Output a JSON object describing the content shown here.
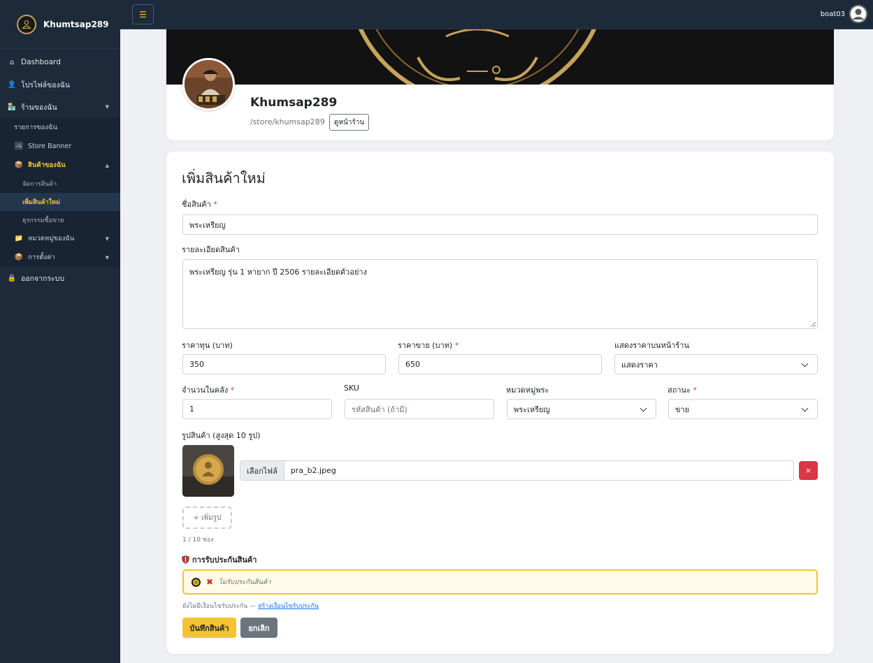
{
  "brand": {
    "name": "Khumtsap289"
  },
  "sidebar": {
    "items": [
      {
        "label": "Dashboard",
        "icon": "home-icon"
      },
      {
        "label": "โปรไฟล์ของฉัน",
        "icon": "user-icon"
      },
      {
        "label": "ร้านของฉัน",
        "icon": "store-icon"
      },
      {
        "label": "รายการของฉัน"
      },
      {
        "label": "Store Banner",
        "icon": "banner-icon"
      },
      {
        "label": "สินค้าของฉัน",
        "icon": "box-icon"
      },
      {
        "label": "จัดการสินค้า"
      },
      {
        "label": "เพิ่มสินค้าใหม่"
      },
      {
        "label": "ธุรกรรมซื้อขาย"
      },
      {
        "label": "หมวดหมู่ของฉัน",
        "icon": "folder-icon"
      },
      {
        "label": "การตั้งค่า",
        "icon": "box-icon"
      },
      {
        "label": "ออกจากระบบ",
        "icon": "lock-icon"
      }
    ]
  },
  "topbar": {
    "toggle": "☰",
    "username": "boat03"
  },
  "profile": {
    "name": "Khumsap289",
    "slug": "/store/khumsap289",
    "view_store": "ดูหน้าร้าน"
  },
  "form": {
    "title": "เพิ่มสินค้าใหม่",
    "name_label": "ชื่อสินค้า",
    "name_value": "พระเหรียญ",
    "desc_label": "รายละเอียดสินค้า",
    "desc_value": "พระเหรียญ รุ่น 1 หายาก ปี 2506 รายละเอียดตัวอย่าง",
    "cost_label": "ราคาทุน (บาท)",
    "cost_value": "350",
    "price_label": "ราคาขาย (บาท)",
    "price_value": "650",
    "show_price_label": "แสดงราคาบนหน้าร้าน",
    "show_price_value": "แสดงราคา",
    "stock_label": "จำนวนในคลัง",
    "stock_value": "1",
    "sku_label": "SKU",
    "sku_placeholder": "รหัสสินค้า (ถ้ามี)",
    "category_label": "หมวดหมู่พระ",
    "category_value": "พระเหรียญ",
    "status_label": "สถานะ",
    "status_value": "ขาย",
    "images_label": "รูปสินค้า (สูงสุด 10 รูป)",
    "file_button": "เลือกไฟล์",
    "file_name": "pra_b2.jpeg",
    "delete": "×",
    "add_image": "+ เพิ่มรูป",
    "image_count": "1 / 10 ช่อง",
    "warranty_title": "การรับประกันสินค้า",
    "warranty_option": "ไม่รับประกันสินค้า",
    "warranty_hint": "ยังไม่มีเงื่อนไขรับประกัน —",
    "warranty_link": "สร้างเงื่อนไขรับประกัน",
    "save": "บันทึกสินค้า",
    "cancel": "ยกเลิก",
    "required_mark": "*"
  },
  "colors": {
    "accent": "#f4c430",
    "sidebar": "#1c2a3a",
    "danger": "#dc3545",
    "secondary": "#6c757d"
  }
}
